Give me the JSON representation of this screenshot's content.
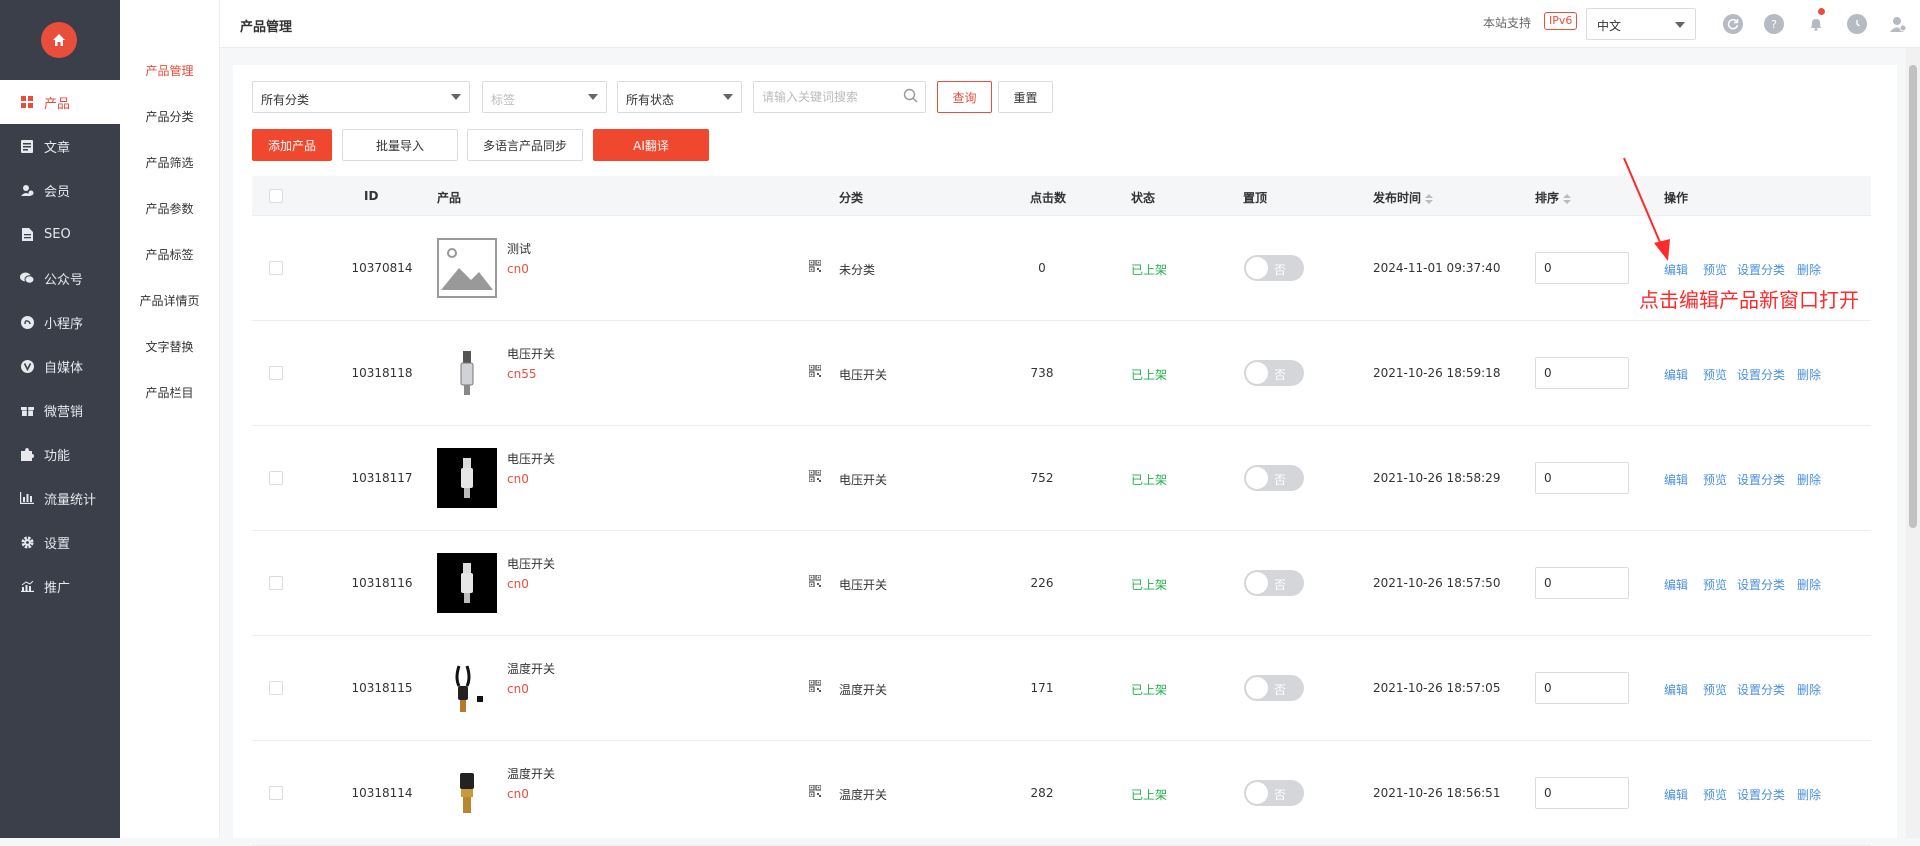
{
  "sidebar": {
    "logo_icon": "home-icon",
    "items": [
      {
        "label": "产品",
        "icon": "grid-icon",
        "active": true
      },
      {
        "label": "文章",
        "icon": "document-icon",
        "active": false
      },
      {
        "label": "会员",
        "icon": "user-icon",
        "active": false
      },
      {
        "label": "SEO",
        "icon": "file-icon",
        "active": false
      },
      {
        "label": "公众号",
        "icon": "wechat-icon",
        "active": false
      },
      {
        "label": "小程序",
        "icon": "miniprogram-icon",
        "active": false
      },
      {
        "label": "自媒体",
        "icon": "media-icon",
        "active": false
      },
      {
        "label": "微营销",
        "icon": "gift-icon",
        "active": false
      },
      {
        "label": "功能",
        "icon": "puzzle-icon",
        "active": false
      },
      {
        "label": "流量统计",
        "icon": "bar-chart-icon",
        "active": false
      },
      {
        "label": "设置",
        "icon": "gear-icon",
        "active": false
      },
      {
        "label": "推广",
        "icon": "trend-chart-icon",
        "active": false
      }
    ]
  },
  "subnav": {
    "items": [
      "产品管理",
      "产品分类",
      "产品筛选",
      "产品参数",
      "产品标签",
      "产品详情页",
      "文字替换",
      "产品栏目"
    ]
  },
  "header": {
    "title": "产品管理",
    "ipv6_label": "本站支持",
    "ipv6_badge": "IPv6",
    "language": "中文"
  },
  "filters": {
    "category": "所有分类",
    "tag_placeholder": "标签",
    "status": "所有状态",
    "search_placeholder": "请输入关键词搜索",
    "query_label": "查询",
    "reset_label": "重置"
  },
  "actions": {
    "add": "添加产品",
    "import": "批量导入",
    "sync": "多语言产品同步",
    "translate": "AI翻译"
  },
  "table": {
    "headers": {
      "id": "ID",
      "product": "产品",
      "category": "分类",
      "clicks": "点击数",
      "status": "状态",
      "pinned": "置顶",
      "published": "发布时间",
      "sort": "排序",
      "ops": "操作"
    },
    "ops": {
      "edit": "编辑",
      "preview": "预览",
      "set_category": "设置分类",
      "delete": "删除"
    },
    "toggle_off_label": "否",
    "rows": [
      {
        "id": "10370814",
        "name": "测试",
        "code": "cn0",
        "category": "未分类",
        "clicks": "0",
        "status": "已上架",
        "date": "2024-11-01 09:37:40",
        "sort": "0",
        "image": "placeholder"
      },
      {
        "id": "10318118",
        "name": "电压开关",
        "code": "cn55",
        "category": "电压开关",
        "clicks": "738",
        "status": "已上架",
        "date": "2021-10-26 18:59:18",
        "sort": "0",
        "image": "switch-light"
      },
      {
        "id": "10318117",
        "name": "电压开关",
        "code": "cn0",
        "category": "电压开关",
        "clicks": "752",
        "status": "已上架",
        "date": "2021-10-26 18:58:29",
        "sort": "0",
        "image": "switch-dark"
      },
      {
        "id": "10318116",
        "name": "电压开关",
        "code": "cn0",
        "category": "电压开关",
        "clicks": "226",
        "status": "已上架",
        "date": "2021-10-26 18:57:50",
        "sort": "0",
        "image": "switch-dark"
      },
      {
        "id": "10318115",
        "name": "温度开关",
        "code": "cn0",
        "category": "温度开关",
        "clicks": "171",
        "status": "已上架",
        "date": "2021-10-26 18:57:05",
        "sort": "0",
        "image": "temp-cable"
      },
      {
        "id": "10318114",
        "name": "温度开关",
        "code": "cn0",
        "category": "温度开关",
        "clicks": "282",
        "status": "已上架",
        "date": "2021-10-26 18:56:51",
        "sort": "0",
        "image": "temp-brass"
      }
    ]
  },
  "annotation": {
    "text": "点击编辑产品新窗口打开",
    "color": "#ff2a2a"
  },
  "colors": {
    "accent": "#e94e3c",
    "sidebar_bg": "#3a3f4a",
    "status_green": "#22b14c",
    "link_blue": "#4a90e2"
  }
}
